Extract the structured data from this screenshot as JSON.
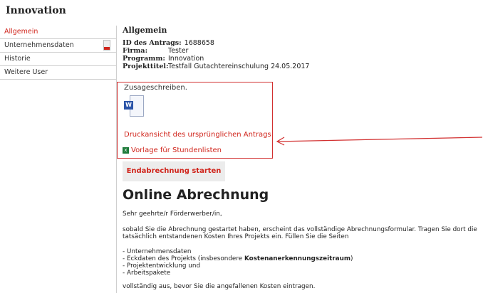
{
  "app": {
    "title": "Innovation"
  },
  "sidebar": {
    "items": [
      {
        "label": "Allgemein",
        "active": true
      },
      {
        "label": "Unternehmensdaten",
        "active": false
      },
      {
        "label": "Historie",
        "active": false
      },
      {
        "label": "Weitere User",
        "active": false
      }
    ]
  },
  "main": {
    "section_title": "Allgemein",
    "fields": {
      "id_label": "ID des Antrags:",
      "id_value": "1688658",
      "firma_label": "Firma:",
      "firma_value": "Tester",
      "programm_label": "Programm:",
      "programm_value": "Innovation",
      "projekttitel_label": "Projekttitel:",
      "projekttitel_value": "Testfall Gutachtereinschulung 24.05.2017"
    },
    "cut_text": "Zusageschreiben.",
    "word_icon": "word-document-icon",
    "print_link": "Druckansicht des ursprünglichen Antrags",
    "template_link": "Vorlage für Stundenlisten",
    "start_button": "Endabrechnung starten",
    "online_heading": "Online Abrechnung",
    "greeting": "Sehr geehrte/r Förderwerber/in,",
    "para1": "sobald Sie die Abrechnung gestartet haben, erscheint das vollständige Abrechnungsformular. Tragen Sie dort die tatsächlich entstandenen Kosten Ihres Projekts ein. Füllen Sie die Seiten",
    "list": {
      "item1": "- Unternehmensdaten",
      "item2_pre": "- Eckdaten des Projekts (insbesondere ",
      "item2_bold": "Kostenanerkennungszeitraum",
      "item2_post": ")",
      "item3": "- Projektentwicklung und",
      "item4": "- Arbeitspakete"
    },
    "para2": "vollständig aus, bevor Sie die angefallenen Kosten eintragen."
  },
  "colors": {
    "accent": "#d0241b",
    "highlight": "#d23030"
  }
}
